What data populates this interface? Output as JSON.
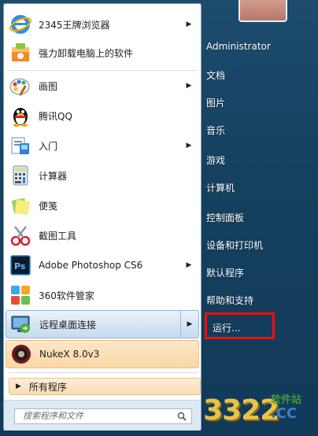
{
  "left_menu": {
    "items": [
      {
        "label": "2345王牌浏览器",
        "icon": "ie-browser-icon",
        "arrow": true
      },
      {
        "label": "强力卸载电脑上的软件",
        "icon": "uninstall-icon",
        "arrow": false
      },
      {
        "label": "画图",
        "icon": "paint-icon",
        "arrow": true
      },
      {
        "label": "腾讯QQ",
        "icon": "qq-penguin-icon",
        "arrow": false
      },
      {
        "label": "入门",
        "icon": "getting-started-icon",
        "arrow": true
      },
      {
        "label": "计算器",
        "icon": "calculator-icon",
        "arrow": false
      },
      {
        "label": "便笺",
        "icon": "sticky-notes-icon",
        "arrow": false
      },
      {
        "label": "截图工具",
        "icon": "snipping-tool-icon",
        "arrow": false
      },
      {
        "label": "Adobe Photoshop CS6",
        "icon": "photoshop-icon",
        "arrow": true
      },
      {
        "label": "360软件管家",
        "icon": "360-software-icon",
        "arrow": false
      },
      {
        "label": "远程桌面连接",
        "icon": "remote-desktop-icon",
        "arrow": true
      },
      {
        "label": "NukeX 8.0v3",
        "icon": "nukex-icon",
        "arrow": false
      }
    ],
    "all_programs": "所有程序",
    "search_placeholder": "搜索程序和文件"
  },
  "right_menu": {
    "user": "Administrator",
    "items": [
      "文档",
      "图片",
      "音乐",
      "游戏",
      "计算机",
      "控制面板",
      "设备和打印机",
      "默认程序",
      "帮助和支持",
      "运行..."
    ]
  },
  "watermark": {
    "number": "3322",
    "top": "软件站",
    "bottom": ".CC"
  },
  "colors": {
    "highlight_border": "#e81212",
    "frame": "#1d4c6f"
  }
}
